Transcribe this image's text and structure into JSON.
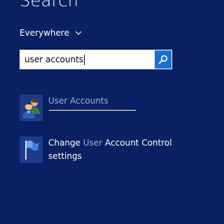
{
  "header": {
    "title": "Search"
  },
  "scope": {
    "label": "Everywhere"
  },
  "search": {
    "value": "user accounts"
  },
  "results": [
    {
      "prefix": "",
      "highlight": "User Accounts",
      "suffix": "",
      "line2": "",
      "icon": "user-accounts-icon"
    },
    {
      "prefix": "Change ",
      "highlight": "User",
      "suffix": " Account Control",
      "line2": "settings",
      "icon": "uac-flag-icon"
    }
  ],
  "colors": {
    "background": "#0b2062",
    "accent": "#1f6fd1",
    "highlight_text": "#9bb0e4"
  }
}
